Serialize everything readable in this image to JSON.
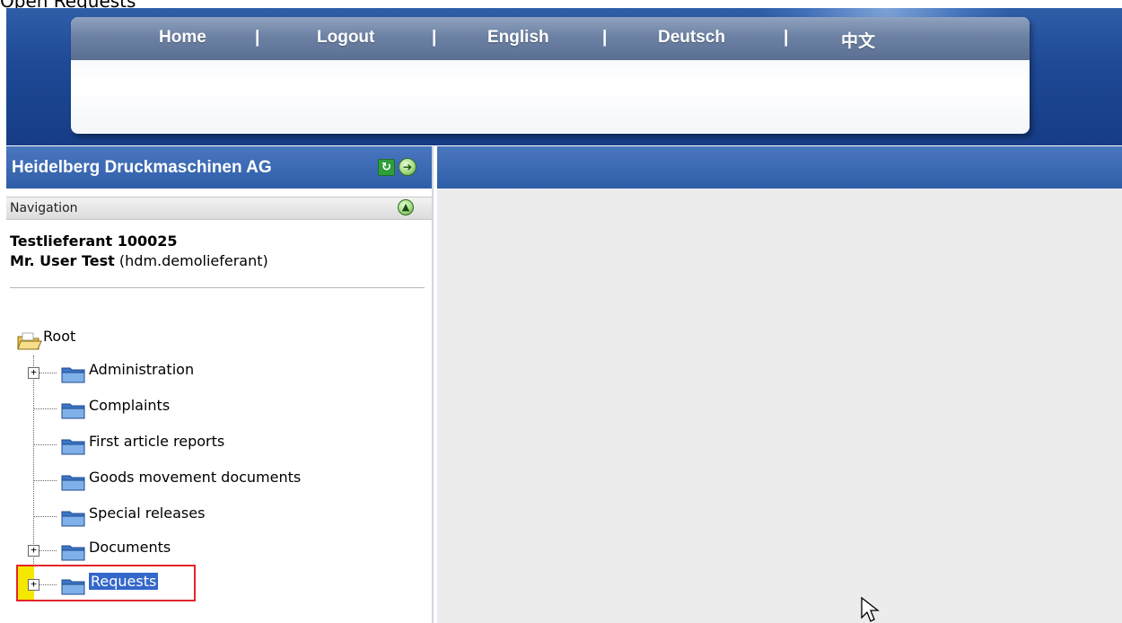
{
  "page": {
    "caption": "Open Requests"
  },
  "header": {
    "nav": [
      "Home",
      "Logout",
      "English",
      "Deutsch",
      "中文"
    ],
    "separator": "|"
  },
  "left_panel": {
    "title": "Heidelberg Druckmaschinen AG",
    "navigation_label": "Navigation",
    "user": {
      "company": "Testlieferant 100025",
      "name": "Mr. User Test",
      "login": "(hdm.demolieferant)"
    },
    "tree": {
      "root": "Root",
      "items": [
        {
          "label": "Administration",
          "expandable": true
        },
        {
          "label": "Complaints",
          "expandable": false
        },
        {
          "label": "First article reports",
          "expandable": false
        },
        {
          "label": "Goods movement documents",
          "expandable": false
        },
        {
          "label": "Special releases",
          "expandable": false
        },
        {
          "label": "Documents",
          "expandable": true
        },
        {
          "label": "Requests",
          "expandable": true,
          "selected": true
        }
      ]
    }
  },
  "colors": {
    "header_blue": "#2f5ea8",
    "selection": "#3367c9",
    "highlight_box": "#e2262c",
    "content_bg": "#ececec"
  },
  "icons": {
    "refresh": "refresh-icon",
    "forward": "circle-arrow-icon",
    "up": "circle-up-icon",
    "root": "open-folder-root-icon",
    "folder": "folder-icon",
    "expand": "plus-expander-icon",
    "cursor": "mouse-cursor-icon"
  }
}
